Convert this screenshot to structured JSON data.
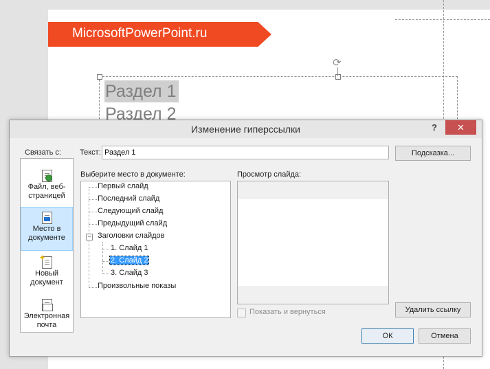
{
  "slide": {
    "banner_text": "MicrosoftPowerPoint.ru",
    "title_line1": "Раздел 1",
    "title_line2": "Раздел 2",
    "rotate_icon": "rotate-handle-icon"
  },
  "dialog": {
    "title": "Изменение гиперссылки",
    "help": "?",
    "close": "✕",
    "link_to_label": "Связать с:",
    "text_label": "Текст:",
    "text_value": "Раздел 1",
    "tooltip_button": "Подсказка...",
    "place_label": "Выберите место в документе:",
    "preview_label": "Просмотр слайда:",
    "nav": [
      {
        "label": "Файл, веб-страницей",
        "icon": "web-page-icon"
      },
      {
        "label": "Место в документе",
        "icon": "place-in-document-icon"
      },
      {
        "label": "Новый документ",
        "icon": "new-document-icon"
      },
      {
        "label": "Электронная почта",
        "icon": "email-icon"
      }
    ],
    "tree": {
      "first": "Первый слайд",
      "last": "Последний слайд",
      "next": "Следующий слайд",
      "previous": "Предыдущий слайд",
      "headers": "Заголовки слайдов",
      "slide1": "1. Слайд 1",
      "slide2": "2. Слайд 2",
      "slide3": "3. Слайд 3",
      "custom": "Произвольные показы",
      "expander": "−"
    },
    "show_and_return": "Показать и вернуться",
    "remove_link_button": "Удалить ссылку",
    "ok_button": "ОК",
    "cancel_button": "Отмена"
  },
  "colors": {
    "banner": "#f04a23",
    "selection": "#3399ff",
    "close": "#c75050",
    "nav_active": "#cde8ff"
  }
}
